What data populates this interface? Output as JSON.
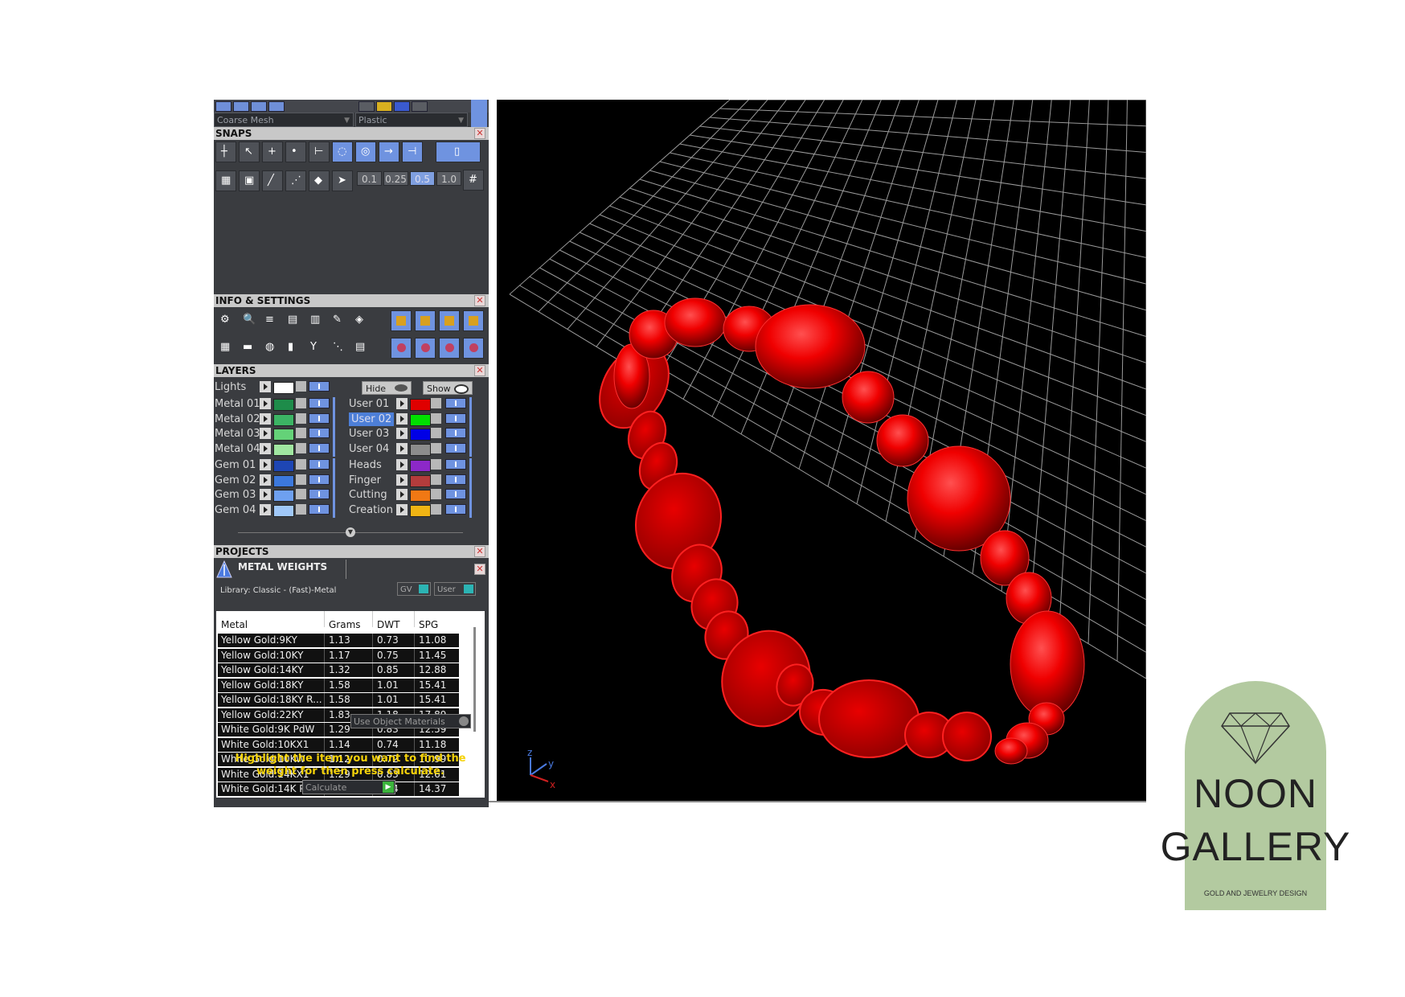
{
  "toolbar": {
    "mesh_select": "Coarse Mesh",
    "material_select": "Plastic"
  },
  "snaps": {
    "title": "SNAPS",
    "increments": [
      "0.1",
      "0.25",
      "0.5",
      "1.0"
    ],
    "selected_increment": "0.5"
  },
  "info_settings": {
    "title": "INFO & SETTINGS"
  },
  "layers": {
    "title": "LAYERS",
    "lights_label": "Lights",
    "hide_label": "Hide",
    "show_label": "Show",
    "left_groups": [
      [
        {
          "name": "Metal 01",
          "color": "#1e8c4a"
        },
        {
          "name": "Metal 02",
          "color": "#3cb464"
        },
        {
          "name": "Metal 03",
          "color": "#64d278"
        },
        {
          "name": "Metal 04",
          "color": "#a0e6a0"
        }
      ],
      [
        {
          "name": "Gem 01",
          "color": "#1e46b4"
        },
        {
          "name": "Gem 02",
          "color": "#3c78dc"
        },
        {
          "name": "Gem 03",
          "color": "#6ea0f0"
        },
        {
          "name": "Gem 04",
          "color": "#a0c8f8"
        }
      ]
    ],
    "right_groups": [
      [
        {
          "name": "User 01",
          "color": "#e00000"
        },
        {
          "name": "User 02",
          "color": "#00e000",
          "selected": true
        },
        {
          "name": "User 03",
          "color": "#0000e6"
        },
        {
          "name": "User 04",
          "color": "#8c8c8c"
        }
      ],
      [
        {
          "name": "Heads",
          "color": "#8c28c8"
        },
        {
          "name": "Finger",
          "color": "#b43c3c"
        },
        {
          "name": "Cutting",
          "color": "#f07814"
        },
        {
          "name": "Creation",
          "color": "#f0b414"
        }
      ]
    ]
  },
  "projects": {
    "title": "PROJECTS"
  },
  "metal_weights": {
    "title": "METAL WEIGHTS",
    "library": "Library: Classic - (Fast)-Metal",
    "gv_label": "GV",
    "user_label": "User",
    "columns": [
      "Metal",
      "Grams",
      "DWT",
      "SPG"
    ],
    "rows": [
      [
        "Yellow Gold:9KY",
        "1.13",
        "0.73",
        "11.08"
      ],
      [
        "Yellow Gold:10KY",
        "1.17",
        "0.75",
        "11.45"
      ],
      [
        "Yellow Gold:14KY",
        "1.32",
        "0.85",
        "12.88"
      ],
      [
        "Yellow Gold:18KY",
        "1.58",
        "1.01",
        "15.41"
      ],
      [
        "Yellow Gold:18KY R...",
        "1.58",
        "1.01",
        "15.41"
      ],
      [
        "Yellow Gold:22KY",
        "1.83",
        "1.18",
        "17.89"
      ],
      [
        "White Gold:9K PdW",
        "1.29",
        "0.83",
        "12.59"
      ],
      [
        "White Gold:10KX1",
        "1.14",
        "0.74",
        "11.18"
      ],
      [
        "White Gold:10KW",
        "1.12",
        "0.72",
        "10.99"
      ],
      [
        "White Gold:14KX1",
        "1.29",
        "0.83",
        "12.61"
      ],
      [
        "White Gold:14K PdW",
        "1.47",
        "0.94",
        "14.37"
      ]
    ],
    "use_object_materials": "Use Object Materials",
    "message": "Highlight the item you want to find the weight for then press calculate.",
    "calculate_label": "Calculate"
  },
  "viewport": {
    "axis_x": "x",
    "axis_y": "y",
    "axis_z": "z",
    "model_color": "#ff0000"
  },
  "logo": {
    "line1": "NOON",
    "line2": "GALLERY",
    "tagline": "GOLD AND JEWELRY DESIGN",
    "bg_color": "#b3caa0"
  }
}
